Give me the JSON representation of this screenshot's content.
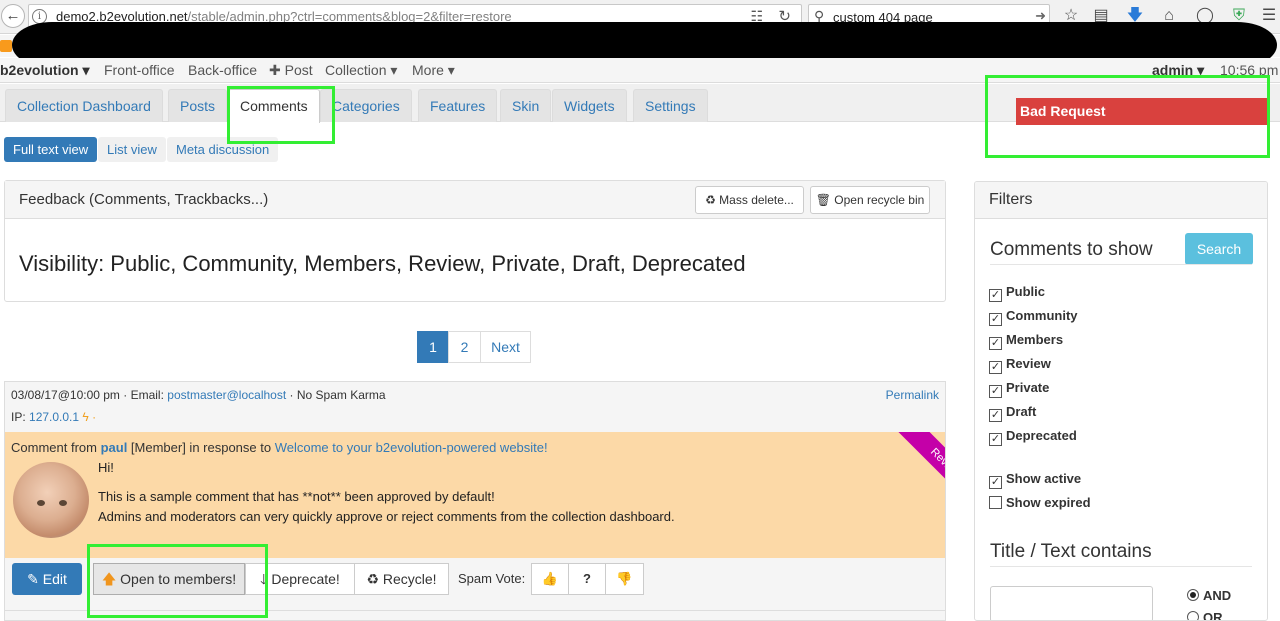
{
  "browser": {
    "url_host": "demo2.b2evolution.net",
    "url_path": "/stable/admin.php?ctrl=comments&blog=2&filter=restore",
    "search_text": "custom 404 page"
  },
  "topmenu": {
    "brand": "b2evolution ▾",
    "front_office": "Front-office",
    "back_office": "Back-office",
    "post": "✚ Post",
    "collection": "Collection ▾",
    "more": "More ▾",
    "user": "admin ▾",
    "time": "10:56 pm"
  },
  "tabs": [
    "Collection Dashboard",
    "Posts",
    "Comments",
    "Categories",
    "Features",
    "Skin",
    "Widgets",
    "Settings"
  ],
  "subtabs": [
    "Full text view",
    "List view",
    "Meta discussion"
  ],
  "error_message": "Bad Request",
  "feedback": {
    "title": "Feedback (Comments, Trackbacks...)",
    "mass_delete": "♻ Mass delete...",
    "recycle_bin": "🗑 Open recycle bin",
    "visibility": "Visibility: Public, Community, Members, Review, Private, Draft, Deprecated"
  },
  "pagination": [
    "1",
    "2",
    "Next"
  ],
  "comment": {
    "meta_date": "03/08/17@10:00 pm · Email: ",
    "email": "postmaster@localhost",
    "karma": " · No Spam Karma",
    "permalink": "Permalink",
    "ip_label": "IP: ",
    "ip": "127.0.0.1",
    "ip_icon": "ϟ ·",
    "from_prefix": "Comment from ",
    "author": "paul",
    "author_role": " [Member] in response to ",
    "post_title": "Welcome to your b2evolution-powered website!",
    "status_ribbon": "Review",
    "lines": [
      "Hi!",
      "This is a sample comment that has **not** been approved by default!",
      "Admins and moderators can very quickly approve or reject comments from the collection dashboard."
    ],
    "actions": {
      "edit": "✎ Edit",
      "open_members": "Open to members!",
      "deprecate": "🡓 Deprecate!",
      "recycle": "♻ Recycle!",
      "spam_vote": "Spam Vote:",
      "vote_ok": "👍",
      "vote_unsure": "?",
      "vote_spam": "👎"
    }
  },
  "filters": {
    "title": "Filters",
    "comments_to_show": "Comments to show",
    "search_button": "Search",
    "statuses": [
      {
        "label": "Public",
        "checked": true
      },
      {
        "label": "Community",
        "checked": true
      },
      {
        "label": "Members",
        "checked": true
      },
      {
        "label": "Review",
        "checked": true
      },
      {
        "label": "Private",
        "checked": true
      },
      {
        "label": "Draft",
        "checked": true
      },
      {
        "label": "Deprecated",
        "checked": true
      }
    ],
    "show_active": "Show active",
    "show_expired": "Show expired",
    "title_text_contains": "Title / Text contains",
    "and_label": "AND",
    "or_label": "OR"
  },
  "colors": {
    "accent": "#337ab7",
    "error": "#d9413e",
    "highlight": "#33ee33",
    "comment_bg": "#fcd9a7",
    "ribbon": "#c400a8"
  }
}
